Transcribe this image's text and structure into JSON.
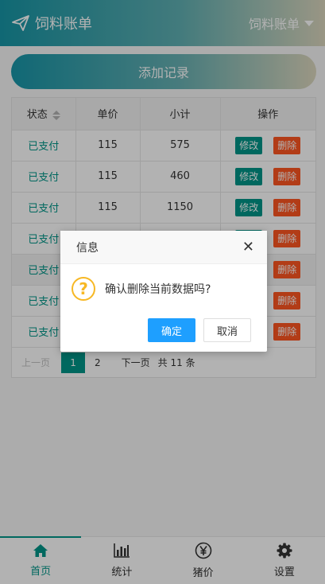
{
  "header": {
    "title": "饲料账单",
    "dropdown_label": "饲料账单"
  },
  "add_button": "添加记录",
  "table": {
    "headers": [
      "状态",
      "单价",
      "小计",
      "操作"
    ],
    "rows": [
      {
        "status": "已支付",
        "price": "115",
        "subtotal": "575"
      },
      {
        "status": "已支付",
        "price": "115",
        "subtotal": "460"
      },
      {
        "status": "已支付",
        "price": "115",
        "subtotal": "1150"
      },
      {
        "status": "已支付",
        "price": "",
        "subtotal": ""
      },
      {
        "status": "已支付",
        "price": "",
        "subtotal": ""
      },
      {
        "status": "已支付",
        "price": "",
        "subtotal": ""
      },
      {
        "status": "已支付",
        "price": "",
        "subtotal": ""
      }
    ],
    "edit_label": "修改",
    "delete_label": "删除"
  },
  "pager": {
    "prev": "上一页",
    "current": "1",
    "page2": "2",
    "next": "下一页",
    "total": "共 11 条"
  },
  "dialog": {
    "title": "信息",
    "message": "确认删除当前数据吗?",
    "ok": "确定",
    "cancel": "取消",
    "close": "✕",
    "icon": "?"
  },
  "tabs": [
    {
      "label": "首页",
      "icon": "home-icon"
    },
    {
      "label": "统计",
      "icon": "bar-chart-icon"
    },
    {
      "label": "猪价",
      "icon": "yen-icon"
    },
    {
      "label": "设置",
      "icon": "gear-icon"
    }
  ],
  "colors": {
    "accent": "#009688",
    "danger": "#ff5722",
    "primary_button": "#1e9fff",
    "warning_icon": "#f7b824"
  }
}
